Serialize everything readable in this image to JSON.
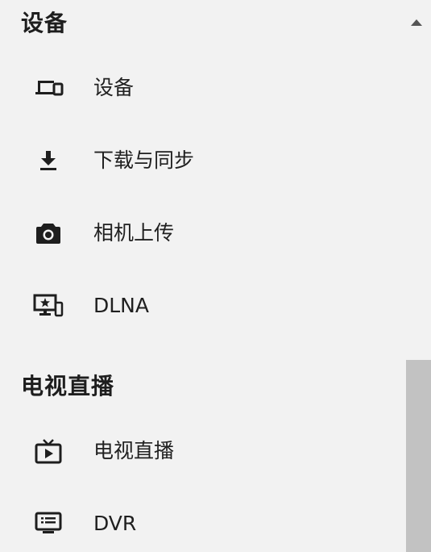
{
  "sections": {
    "devices": {
      "title": "设备",
      "items": [
        {
          "label": "设备",
          "icon": "devices-icon"
        },
        {
          "label": "下载与同步",
          "icon": "download-icon"
        },
        {
          "label": "相机上传",
          "icon": "camera-icon"
        },
        {
          "label": "DLNA",
          "icon": "dlna-icon"
        }
      ]
    },
    "livetv": {
      "title": "电视直播",
      "items": [
        {
          "label": "电视直播",
          "icon": "live-tv-icon"
        },
        {
          "label": "DVR",
          "icon": "dvr-icon"
        }
      ]
    }
  },
  "colors": {
    "background": "#f2f2f2",
    "text": "#202020",
    "scrollbar_thumb": "#c2c2c2"
  }
}
